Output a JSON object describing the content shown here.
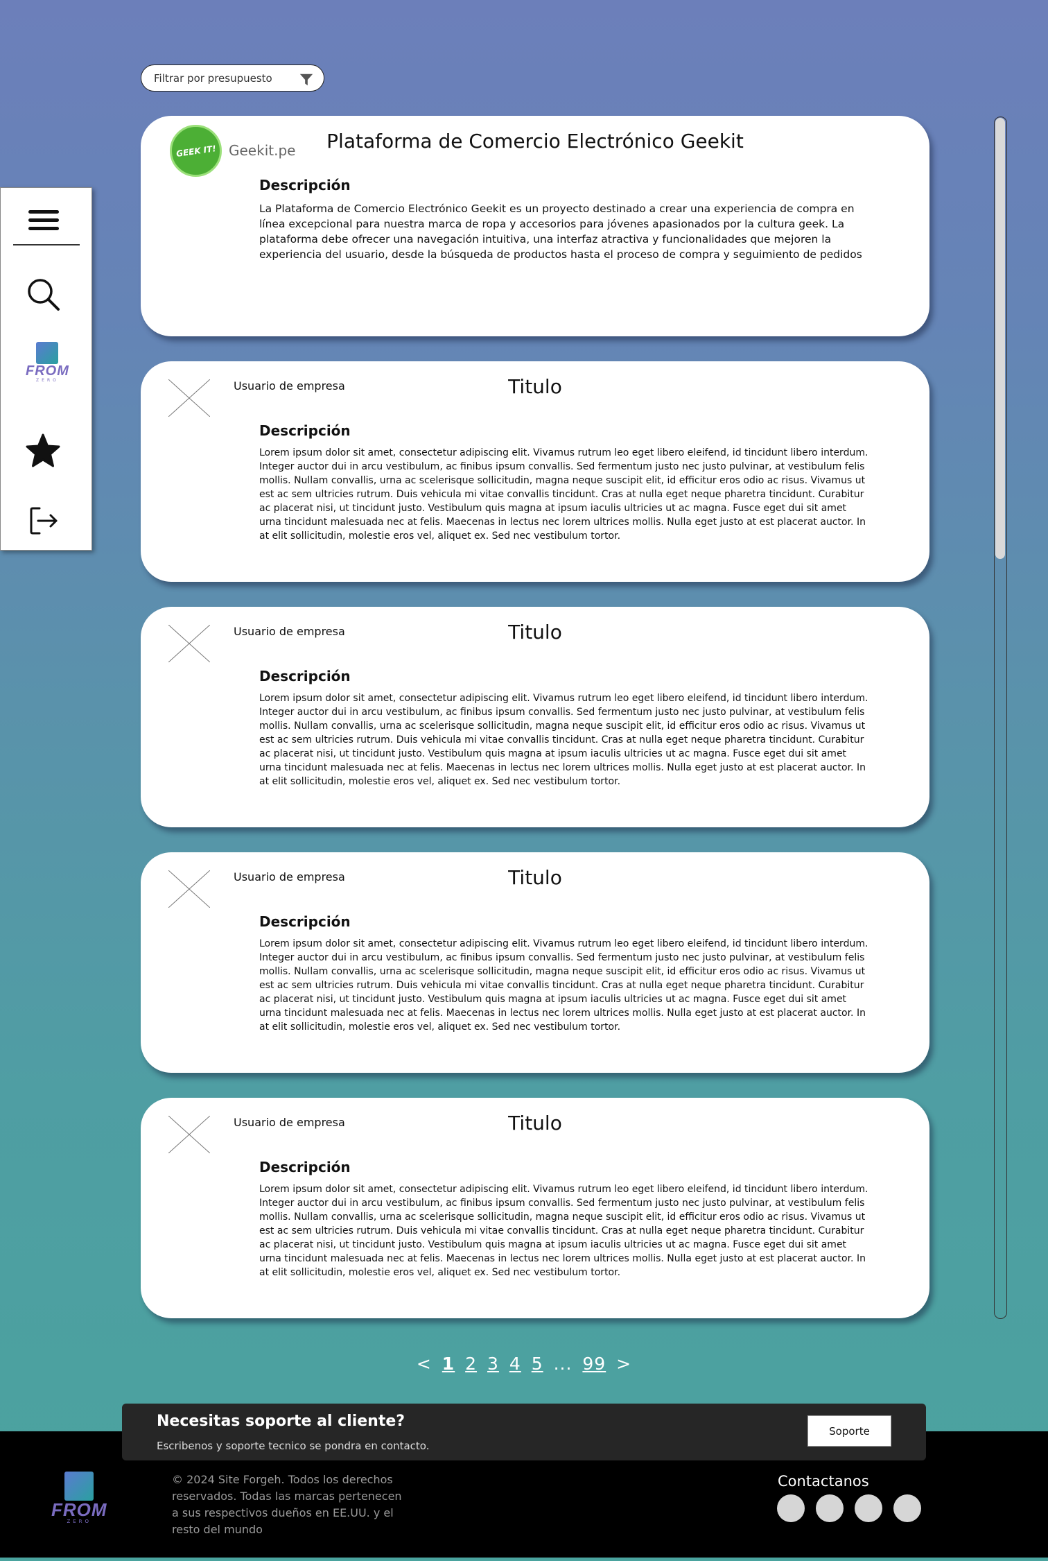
{
  "filter": {
    "label": "Filtrar por presupuesto",
    "icon": "funnel-icon"
  },
  "sidenav": {
    "items": [
      {
        "name": "menu",
        "icon": "hamburger-icon"
      },
      {
        "name": "search",
        "icon": "search-icon"
      },
      {
        "name": "from-zero",
        "icon": "from-zero-logo",
        "logo_text": "FROM",
        "logo_sub": "ZERO"
      },
      {
        "name": "favorites",
        "icon": "star-icon"
      },
      {
        "name": "logout",
        "icon": "logout-icon"
      }
    ]
  },
  "cards": [
    {
      "company": "Geekit.pe",
      "logo_text": "GEEK IT!",
      "title": "Plataforma de Comercio Electrónico Geekit",
      "desc_heading": "Descripción",
      "description": "La Plataforma de Comercio Electrónico Geekit es un proyecto destinado a crear una experiencia de compra en línea excepcional para nuestra marca de ropa y accesorios para jóvenes apasionados por la cultura geek. La plataforma debe ofrecer una navegación intuitiva, una interfaz atractiva y funcionalidades que mejoren la experiencia del usuario, desde la búsqueda de productos hasta el proceso de compra y seguimiento de pedidos"
    },
    {
      "company": "Usuario de empresa",
      "title": "Titulo",
      "desc_heading": "Descripción",
      "description": "Lorem ipsum dolor sit amet, consectetur adipiscing elit. Vivamus rutrum leo eget libero eleifend, id tincidunt libero interdum. Integer auctor dui in arcu vestibulum, ac finibus ipsum convallis. Sed fermentum justo nec justo pulvinar, at vestibulum felis mollis. Nullam convallis, urna ac scelerisque sollicitudin, magna neque suscipit elit, id efficitur eros odio ac risus. Vivamus ut est ac sem ultricies rutrum. Duis vehicula mi vitae convallis tincidunt. Cras at nulla eget neque pharetra tincidunt. Curabitur ac placerat nisi, ut tincidunt justo. Vestibulum quis magna at ipsum iaculis ultricies ut ac magna. Fusce eget dui sit amet urna tincidunt malesuada nec at felis. Maecenas in lectus nec lorem ultrices mollis. Nulla eget justo at est placerat auctor. In at elit sollicitudin, molestie eros vel, aliquet ex. Sed nec vestibulum tortor."
    },
    {
      "company": "Usuario de empresa",
      "title": "Titulo",
      "desc_heading": "Descripción",
      "description": "Lorem ipsum dolor sit amet, consectetur adipiscing elit. Vivamus rutrum leo eget libero eleifend, id tincidunt libero interdum. Integer auctor dui in arcu vestibulum, ac finibus ipsum convallis. Sed fermentum justo nec justo pulvinar, at vestibulum felis mollis. Nullam convallis, urna ac scelerisque sollicitudin, magna neque suscipit elit, id efficitur eros odio ac risus. Vivamus ut est ac sem ultricies rutrum. Duis vehicula mi vitae convallis tincidunt. Cras at nulla eget neque pharetra tincidunt. Curabitur ac placerat nisi, ut tincidunt justo. Vestibulum quis magna at ipsum iaculis ultricies ut ac magna. Fusce eget dui sit amet urna tincidunt malesuada nec at felis. Maecenas in lectus nec lorem ultrices mollis. Nulla eget justo at est placerat auctor. In at elit sollicitudin, molestie eros vel, aliquet ex. Sed nec vestibulum tortor."
    },
    {
      "company": "Usuario de empresa",
      "title": "Titulo",
      "desc_heading": "Descripción",
      "description": "Lorem ipsum dolor sit amet, consectetur adipiscing elit. Vivamus rutrum leo eget libero eleifend, id tincidunt libero interdum. Integer auctor dui in arcu vestibulum, ac finibus ipsum convallis. Sed fermentum justo nec justo pulvinar, at vestibulum felis mollis. Nullam convallis, urna ac scelerisque sollicitudin, magna neque suscipit elit, id efficitur eros odio ac risus. Vivamus ut est ac sem ultricies rutrum. Duis vehicula mi vitae convallis tincidunt. Cras at nulla eget neque pharetra tincidunt. Curabitur ac placerat nisi, ut tincidunt justo. Vestibulum quis magna at ipsum iaculis ultricies ut ac magna. Fusce eget dui sit amet urna tincidunt malesuada nec at felis. Maecenas in lectus nec lorem ultrices mollis. Nulla eget justo at est placerat auctor. In at elit sollicitudin, molestie eros vel, aliquet ex. Sed nec vestibulum tortor."
    },
    {
      "company": "Usuario de empresa",
      "title": "Titulo",
      "desc_heading": "Descripción",
      "description": "Lorem ipsum dolor sit amet, consectetur adipiscing elit. Vivamus rutrum leo eget libero eleifend, id tincidunt libero interdum. Integer auctor dui in arcu vestibulum, ac finibus ipsum convallis. Sed fermentum justo nec justo pulvinar, at vestibulum felis mollis. Nullam convallis, urna ac scelerisque sollicitudin, magna neque suscipit elit, id efficitur eros odio ac risus. Vivamus ut est ac sem ultricies rutrum. Duis vehicula mi vitae convallis tincidunt. Cras at nulla eget neque pharetra tincidunt. Curabitur ac placerat nisi, ut tincidunt justo. Vestibulum quis magna at ipsum iaculis ultricies ut ac magna. Fusce eget dui sit amet urna tincidunt malesuada nec at felis. Maecenas in lectus nec lorem ultrices mollis. Nulla eget justo at est placerat auctor. In at elit sollicitudin, molestie eros vel, aliquet ex. Sed nec vestibulum tortor."
    }
  ],
  "pagination": {
    "prev": "<",
    "pages": [
      "1",
      "2",
      "3",
      "4",
      "5"
    ],
    "ellipsis": "...",
    "last": "99",
    "next": ">",
    "current": "1"
  },
  "support": {
    "heading": "Necesitas soporte al cliente?",
    "text": "Escribenos y soporte tecnico se pondra en contacto.",
    "button": "Soporte"
  },
  "footer": {
    "logo_text": "FROM",
    "logo_sub": "ZERO",
    "copyright": "© 2024 Site Forgeh. Todos los derechos reservados. Todas las marcas pertenecen a sus respectivos dueños en EE.UU. y el resto del mundo",
    "contact_heading": "Contactanos",
    "social_count": 4
  },
  "colors": {
    "bg_top": "#6c7fba",
    "bg_bottom": "#4aa39e",
    "card": "#ffffff",
    "footer": "#000000",
    "support_bar": "#262626",
    "social": "#d6d6d6"
  }
}
